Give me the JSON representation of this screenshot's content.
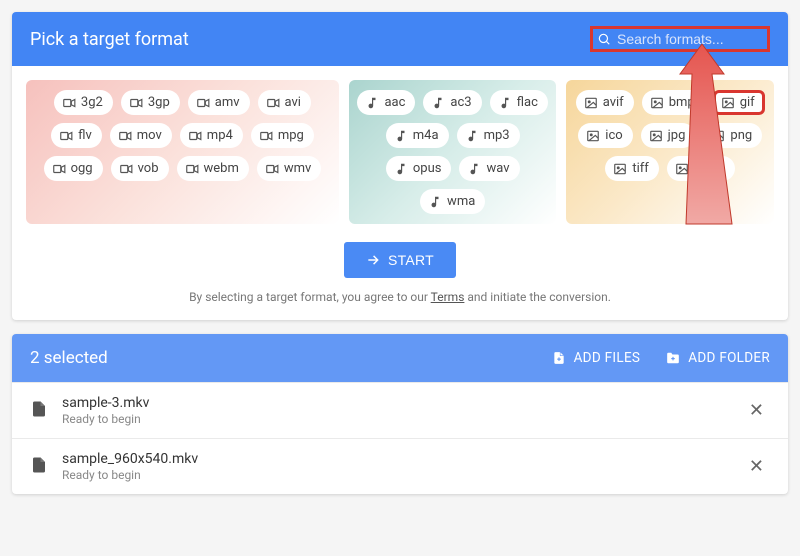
{
  "header": {
    "title": "Pick a target format",
    "search_placeholder": "Search formats..."
  },
  "panels": {
    "video": [
      "3g2",
      "3gp",
      "amv",
      "avi",
      "flv",
      "mov",
      "mp4",
      "mpg",
      "ogg",
      "vob",
      "webm",
      "wmv"
    ],
    "audio": [
      "aac",
      "ac3",
      "flac",
      "m4a",
      "mp3",
      "opus",
      "wav",
      "wma"
    ],
    "image": [
      "avif",
      "bmp",
      "gif",
      "ico",
      "jpg",
      "png",
      "tiff",
      "webp"
    ]
  },
  "highlight_format": "gif",
  "start_label": "START",
  "terms": {
    "pre": "By selecting a target format, you agree to our ",
    "link": "Terms",
    "post": " and initiate the conversion."
  },
  "queue": {
    "selected_label": "2 selected",
    "add_files_label": "ADD FILES",
    "add_folder_label": "ADD FOLDER",
    "files": [
      {
        "name": "sample-3.mkv",
        "status": "Ready to begin"
      },
      {
        "name": "sample_960x540.mkv",
        "status": "Ready to begin"
      }
    ]
  }
}
